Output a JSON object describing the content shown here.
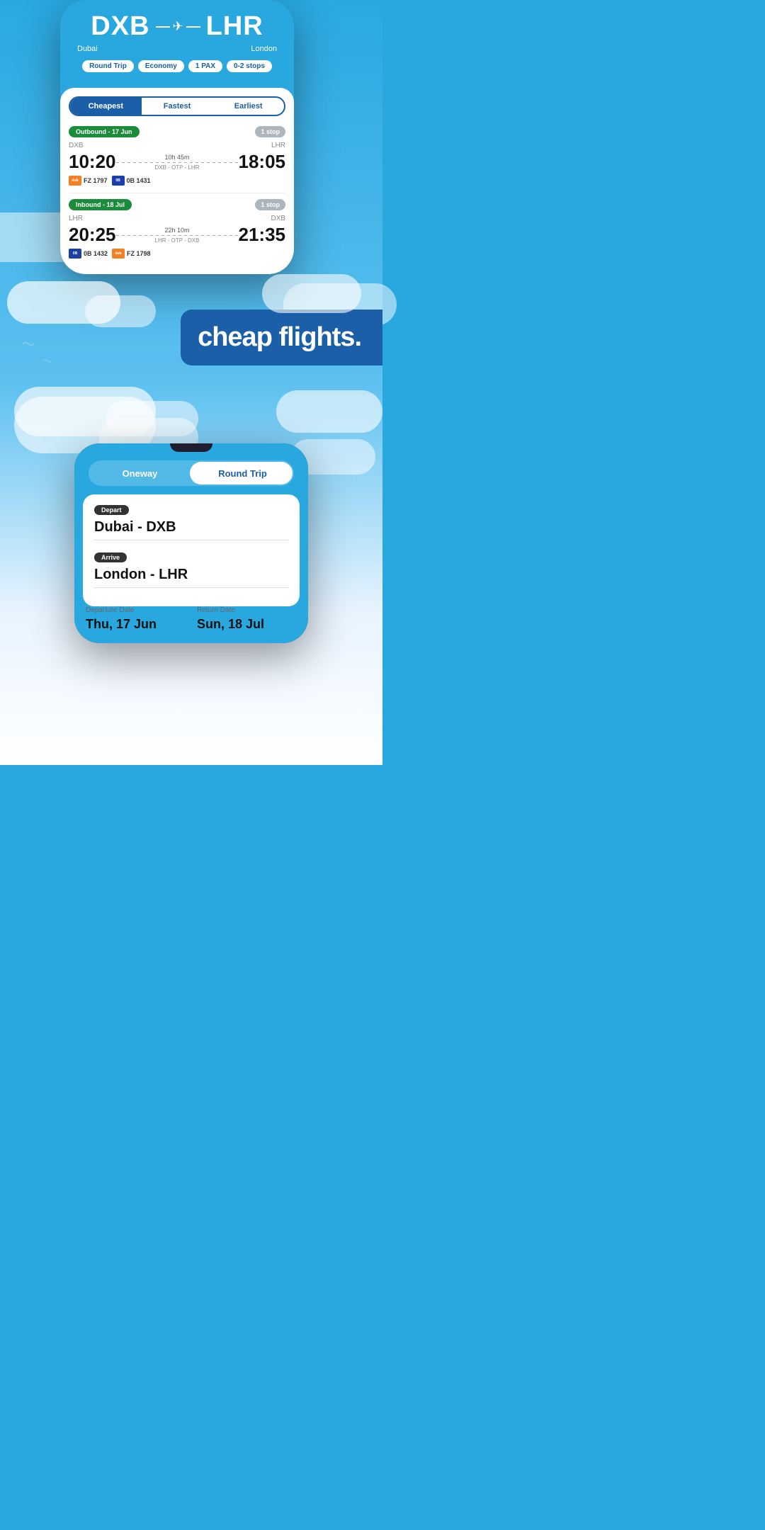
{
  "phone1": {
    "origin_code": "DXB",
    "origin_city": "Dubai",
    "dest_code": "LHR",
    "dest_city": "London",
    "filters": {
      "trip_type": "Round Trip",
      "cabin": "Economy",
      "passengers": "1 PAX",
      "stops": "0-2 stops"
    },
    "sort_tabs": [
      "Cheapest",
      "Fastest",
      "Earliest"
    ],
    "active_tab": "Cheapest",
    "outbound": {
      "label": "Outbound - 17 Jun",
      "stop_badge": "1 stop",
      "origin": "DXB",
      "destination": "LHR",
      "depart_time": "10:20",
      "arrive_time": "18:05",
      "duration": "10h 45m",
      "route": "DXB - OTP - LHR",
      "airlines": [
        {
          "code": "FZ 1797",
          "color": "orange",
          "short": "dub"
        },
        {
          "code": "0B 1431",
          "color": "blue",
          "short": "0B"
        }
      ]
    },
    "inbound": {
      "label": "Inbound - 18 Jul",
      "stop_badge": "1 stop",
      "origin": "LHR",
      "destination": "DXB",
      "depart_time": "20:25",
      "arrive_time": "21:35",
      "duration": "22h 10m",
      "route": "LHR - OTP - DXB",
      "airlines": [
        {
          "code": "0B 1432",
          "color": "blue",
          "short": "0B"
        },
        {
          "code": "FZ 1798",
          "color": "orange",
          "short": "dub"
        }
      ]
    }
  },
  "cheap_flights_text": "cheap flights.",
  "phone2": {
    "toggle": {
      "option1": "Oneway",
      "option2": "Round Trip",
      "active": "Round Trip"
    },
    "depart_label": "Depart",
    "depart_value": "Dubai - DXB",
    "arrive_label": "Arrive",
    "arrive_value": "London - LHR",
    "departure_date_label": "Departure Date",
    "departure_date_value": "Thu, 17 Jun",
    "return_date_label": "Return Date",
    "return_date_value": "Sun, 18 Jul"
  }
}
